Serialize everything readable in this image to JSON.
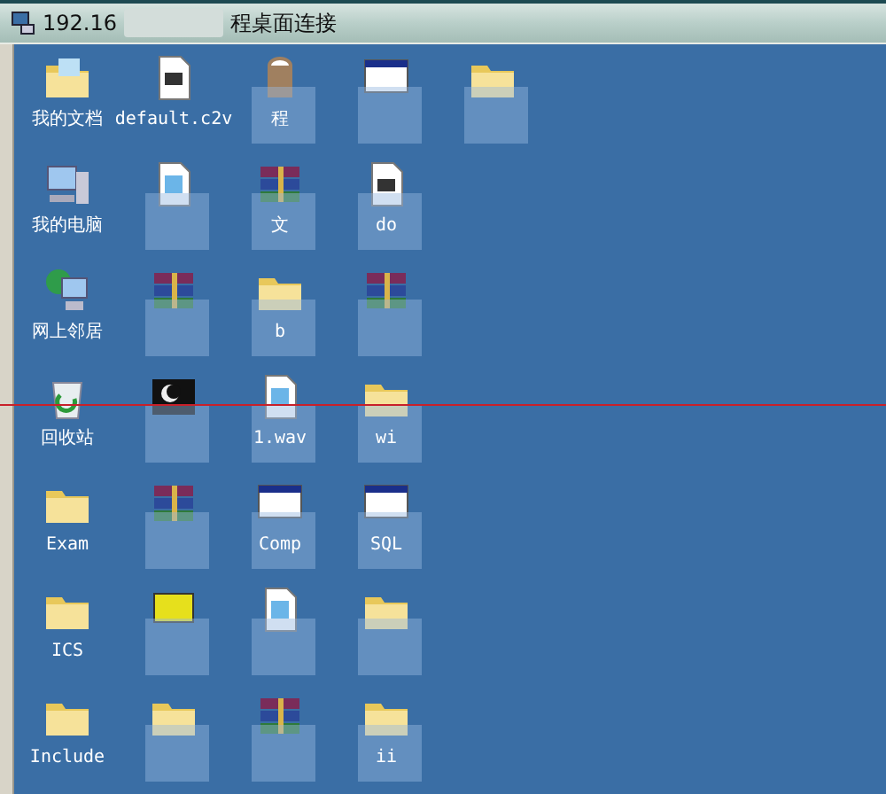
{
  "window": {
    "title_parts": [
      "192.16",
      "程桌面连接"
    ]
  },
  "desktop": {
    "rows": [
      {
        "icons": [
          {
            "kind": "documents",
            "label": "我的文档",
            "obscured": false
          },
          {
            "kind": "document",
            "label": "default.c2v",
            "obscured": false
          },
          {
            "kind": "bag",
            "label": "程",
            "obscured": true
          },
          {
            "kind": "window",
            "obscured": true
          },
          {
            "kind": "folder",
            "obscured": true
          }
        ]
      },
      {
        "icons": [
          {
            "kind": "computer",
            "label": "我的电脑",
            "obscured": false
          },
          {
            "kind": "page",
            "obscured": true
          },
          {
            "kind": "rar",
            "label": "文",
            "obscured": true
          },
          {
            "kind": "document",
            "label": "do",
            "obscured": true
          }
        ]
      },
      {
        "icons": [
          {
            "kind": "network",
            "label": "网上邻居",
            "obscured": false
          },
          {
            "kind": "rar",
            "obscured": true
          },
          {
            "kind": "folder",
            "label": "b",
            "obscured": true
          },
          {
            "kind": "rar",
            "obscured": true
          }
        ]
      },
      {
        "icons": [
          {
            "kind": "recycle",
            "label": "回收站",
            "obscured": false
          },
          {
            "kind": "media",
            "obscured": true
          },
          {
            "kind": "page",
            "label": "1.wav",
            "obscured": true
          },
          {
            "kind": "folder",
            "label": "wi",
            "obscured": true
          }
        ]
      },
      {
        "icons": [
          {
            "kind": "folder",
            "label": "Exam",
            "obscured": false
          },
          {
            "kind": "rar",
            "obscured": true
          },
          {
            "kind": "window",
            "label": "Comp",
            "obscured": true
          },
          {
            "kind": "window",
            "label": "SQL",
            "obscured": true
          }
        ]
      },
      {
        "icons": [
          {
            "kind": "folder",
            "label": "ICS",
            "obscured": false
          },
          {
            "kind": "yellow",
            "obscured": true
          },
          {
            "kind": "page",
            "obscured": true
          },
          {
            "kind": "folder",
            "obscured": true
          }
        ]
      },
      {
        "icons": [
          {
            "kind": "folder",
            "label": "Include",
            "obscured": false
          },
          {
            "kind": "folder",
            "obscured": true
          },
          {
            "kind": "rar",
            "obscured": true
          },
          {
            "kind": "folder",
            "label": "ii",
            "obscured": true
          }
        ]
      }
    ]
  }
}
